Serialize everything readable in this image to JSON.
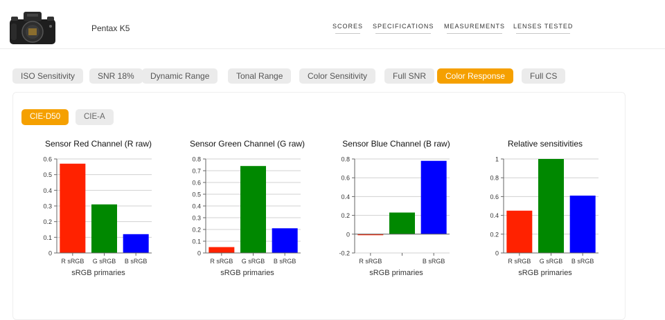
{
  "header": {
    "camera_name": "Pentax K5",
    "nav": [
      "SCORES",
      "SPECIFICATIONS",
      "MEASUREMENTS",
      "LENSES TESTED"
    ]
  },
  "tabs": [
    "ISO Sensitivity",
    "SNR 18%",
    "Dynamic Range",
    "Tonal Range",
    "Color Sensitivity",
    "Full SNR",
    "Color Response",
    "Full CS"
  ],
  "active_tab": "Color Response",
  "illuminants": [
    "CIE-D50",
    "CIE-A"
  ],
  "active_illuminant": "CIE-D50",
  "colors": {
    "accent": "#f5a000",
    "red": "#ff2200",
    "green": "#008800",
    "blue": "#0000ff"
  },
  "chart_data": [
    {
      "type": "bar",
      "title": "Sensor Red Channel (R raw)",
      "xlabel": "sRGB primaries",
      "categories": [
        "R sRGB",
        "G sRGB",
        "B sRGB"
      ],
      "values": [
        0.57,
        0.31,
        0.12
      ],
      "colors": [
        "#ff2200",
        "#008800",
        "#0000ff"
      ],
      "ylim": [
        0,
        0.6
      ],
      "yticks": [
        0,
        0.1,
        0.2,
        0.3,
        0.4,
        0.5,
        0.6
      ],
      "grid": true
    },
    {
      "type": "bar",
      "title": "Sensor Green Channel (G raw)",
      "xlabel": "sRGB primaries",
      "categories": [
        "R sRGB",
        "G sRGB",
        "B sRGB"
      ],
      "values": [
        0.05,
        0.74,
        0.21
      ],
      "colors": [
        "#ff2200",
        "#008800",
        "#0000ff"
      ],
      "ylim": [
        0,
        0.8
      ],
      "yticks": [
        0,
        0.1,
        0.2,
        0.3,
        0.4,
        0.5,
        0.6,
        0.7,
        0.8
      ],
      "grid": true
    },
    {
      "type": "bar",
      "title": "Sensor Blue Channel (B raw)",
      "xlabel": "sRGB primaries",
      "categories": [
        "R sRGB",
        "",
        "B sRGB"
      ],
      "values": [
        -0.01,
        0.23,
        0.78
      ],
      "colors": [
        "#ff2200",
        "#008800",
        "#0000ff"
      ],
      "ylim": [
        -0.2,
        0.8
      ],
      "yticks": [
        -0.2,
        0,
        0.2,
        0.4,
        0.6,
        0.8
      ],
      "grid": true
    },
    {
      "type": "bar",
      "title": "Relative sensitivities",
      "xlabel": "sRGB primaries",
      "categories": [
        "R sRGB",
        "G sRGB",
        "B sRGB"
      ],
      "values": [
        0.45,
        1.0,
        0.61
      ],
      "colors": [
        "#ff2200",
        "#008800",
        "#0000ff"
      ],
      "ylim": [
        0,
        1
      ],
      "yticks": [
        0,
        0.2,
        0.4,
        0.6,
        0.8,
        1
      ],
      "grid": true
    }
  ]
}
